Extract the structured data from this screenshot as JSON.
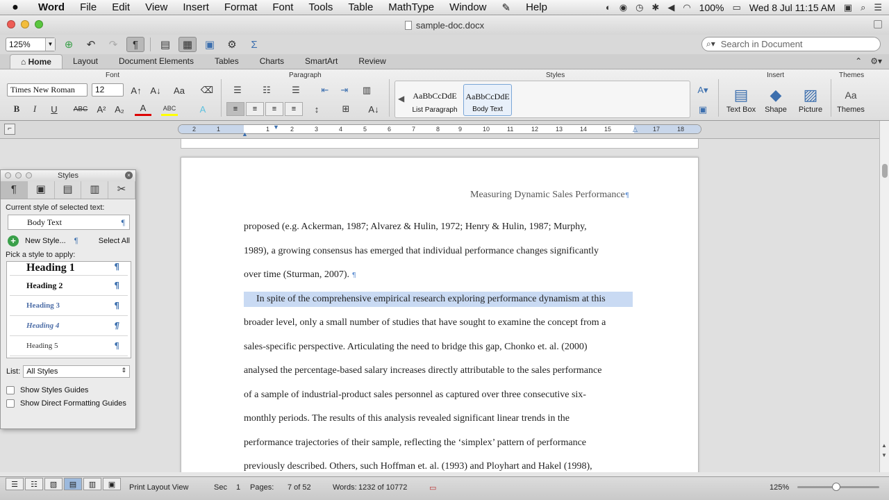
{
  "menubar": {
    "apple": "",
    "items": [
      "Word",
      "File",
      "Edit",
      "View",
      "Insert",
      "Format",
      "Font",
      "Tools",
      "Table",
      "MathType",
      "Window",
      "Help"
    ],
    "battery": "100%",
    "clock": "Wed 8 Jul  11:15 AM"
  },
  "window": {
    "title": "sample-doc.docx"
  },
  "toolbar": {
    "zoom": "125%",
    "search_placeholder": "Search in Document"
  },
  "ribbon_tabs": [
    "Home",
    "Layout",
    "Document Elements",
    "Tables",
    "Charts",
    "SmartArt",
    "Review"
  ],
  "ribbon": {
    "groups": {
      "font": "Font",
      "paragraph": "Paragraph",
      "styles": "Styles",
      "insert": "Insert",
      "themes": "Themes"
    },
    "font_name": "Times New Roman",
    "font_size": "12",
    "style_cards": [
      {
        "sample": "AaBbCcDdE",
        "caption": "List Paragraph"
      },
      {
        "sample": "AaBbCcDdE",
        "caption": "Body Text"
      }
    ],
    "insert_items": [
      "Text Box",
      "Shape",
      "Picture"
    ],
    "themes_label": "Themes"
  },
  "ruler": {
    "ticks": [
      "2",
      "1",
      "1",
      "2",
      "3",
      "4",
      "5",
      "6",
      "7",
      "8",
      "9",
      "10",
      "11",
      "12",
      "13",
      "14",
      "15",
      "17",
      "18"
    ]
  },
  "document": {
    "running_head": "Measuring Dynamic Sales Performance",
    "lines": [
      "proposed (e.g. Ackerman, 1987; Alvarez & Hulin, 1972; Henry & Hulin, 1987; Murphy,",
      "1989), a growing consensus has emerged that individual performance changes significantly",
      "over time (Sturman, 2007).",
      "In spite of the comprehensive empirical research exploring performance dynamism at this",
      "broader level, only a small number of studies that have sought to examine the concept from a",
      "sales-specific perspective. Articulating the need to bridge this gap, Chonko et. al. (2000)",
      "analysed the percentage-based salary increases directly attributable to the sales performance",
      "of a sample of industrial-product sales personnel as captured over three consecutive six-",
      "monthly periods. The results of this analysis revealed significant linear trends in the",
      "performance trajectories of their sample, reflecting the ‘simplex’ pattern of performance",
      "previously described. Others, such Hoffman et. al. (1993) and Ployhart and Hakel (1998),"
    ]
  },
  "styles_palette": {
    "title": "Styles",
    "current_label": "Current style of selected text:",
    "current_style": "Body Text",
    "new_style": "New Style...",
    "select_all": "Select All",
    "pick_label": "Pick a style to apply:",
    "styles": [
      "Heading 1",
      "Heading 2",
      "Heading 3",
      "Heading 4",
      "Heading 5"
    ],
    "list_label": "List:",
    "list_value": "All Styles",
    "show_styles_guides": "Show Styles Guides",
    "show_direct_formatting": "Show Direct Formatting Guides"
  },
  "statusbar": {
    "view": "Print Layout View",
    "sec_label": "Sec",
    "sec_value": "1",
    "pages_label": "Pages:",
    "pages_value": "7 of 52",
    "words_label": "Words:",
    "words_value": "1232 of 10772",
    "zoom": "125%"
  }
}
